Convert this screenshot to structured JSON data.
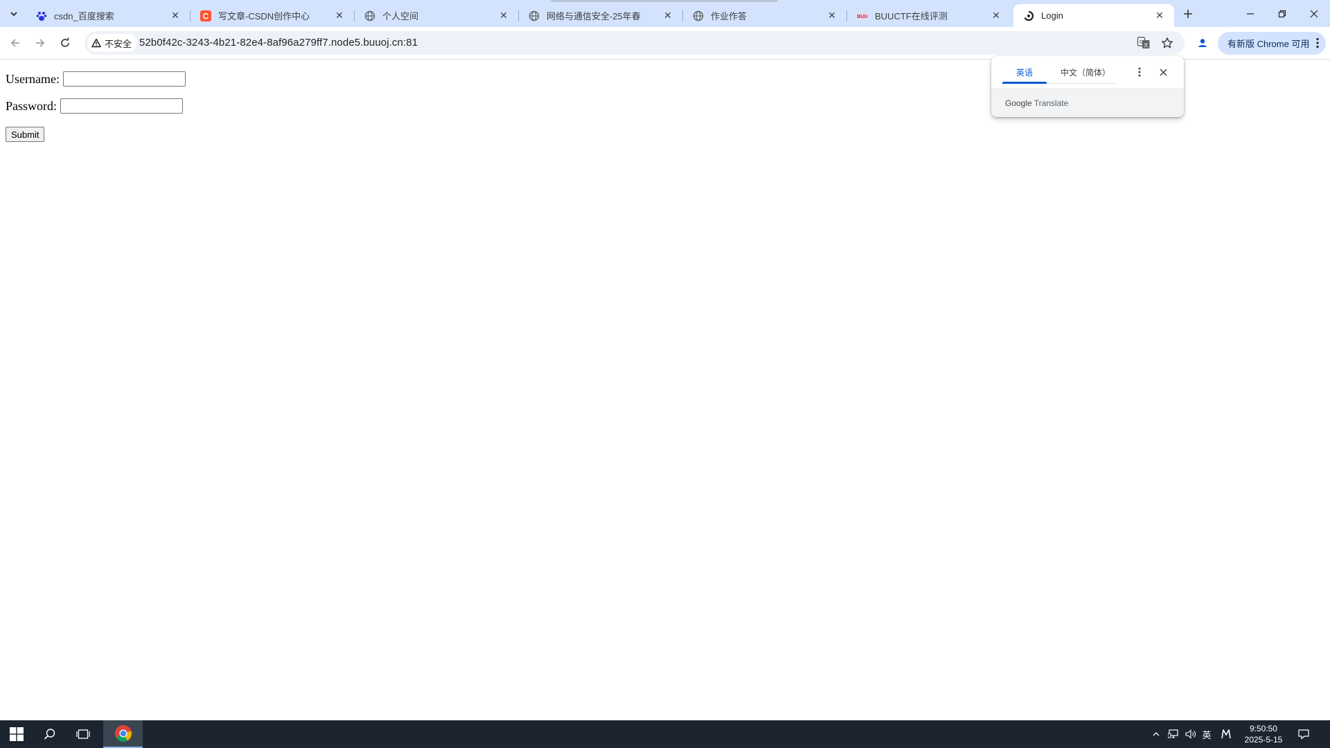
{
  "browser": {
    "tabs": [
      {
        "title": "csdn_百度搜索",
        "favicon": "baidu-paw-icon",
        "active": false
      },
      {
        "title": "写文章-CSDN创作中心",
        "favicon": "csdn-icon",
        "active": false
      },
      {
        "title": "个人空间",
        "favicon": "globe-icon",
        "active": false
      },
      {
        "title": "网络与通信安全-25年春",
        "favicon": "globe-icon",
        "active": false
      },
      {
        "title": "作业作答",
        "favicon": "globe-icon",
        "active": false
      },
      {
        "title": "BUUCTF在线评测",
        "favicon": "buuctf-icon",
        "active": false
      },
      {
        "title": "Login",
        "favicon": "loading-icon",
        "active": true
      }
    ],
    "security_label": "不安全",
    "url": "52b0f42c-3243-4b21-82e4-8af96a279ff7.node5.buuoj.cn:81",
    "update_label": "有新版 Chrome 可用",
    "accent_color": "#d3e3fd"
  },
  "translate_popup": {
    "source_lang": "英语",
    "target_lang": "中文（简体）",
    "brand_google": "Google",
    "brand_translate": "Translate"
  },
  "page": {
    "username_label": "Username:",
    "password_label": "Password:",
    "username_value": "",
    "password_value": "",
    "submit_label": "Submit"
  },
  "taskbar": {
    "ime_label": "英",
    "time": "9:50:50",
    "date": "2025-5-15"
  }
}
